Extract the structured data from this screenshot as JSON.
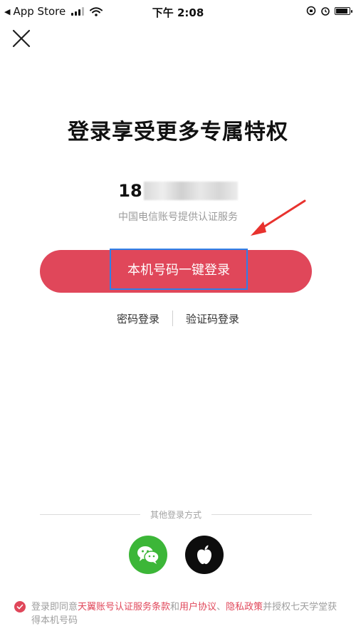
{
  "status_bar": {
    "back_label": "App Store",
    "time": "下午 2:08"
  },
  "title": "登录享受更多专属特权",
  "phone": {
    "number_visible": "18",
    "provider_text": "中国电信账号提供认证服务"
  },
  "login_button": {
    "label": "本机号码一键登录"
  },
  "alternatives": {
    "password_login": "密码登录",
    "code_login": "验证码登录"
  },
  "other_methods": {
    "label": "其他登录方式"
  },
  "agreement": {
    "prefix": "登录即同意",
    "link_tianyi": "天翼账号认证服务条款",
    "and": "和",
    "link_user": "用户协议",
    "separator": "、",
    "link_privacy": "隐私政策",
    "suffix": "并授权七天学堂获得本机号码"
  },
  "colors": {
    "accent": "#e0475a",
    "highlight_box": "#2f7fe8",
    "wechat": "#3cb638",
    "apple": "#0d0d0d"
  }
}
